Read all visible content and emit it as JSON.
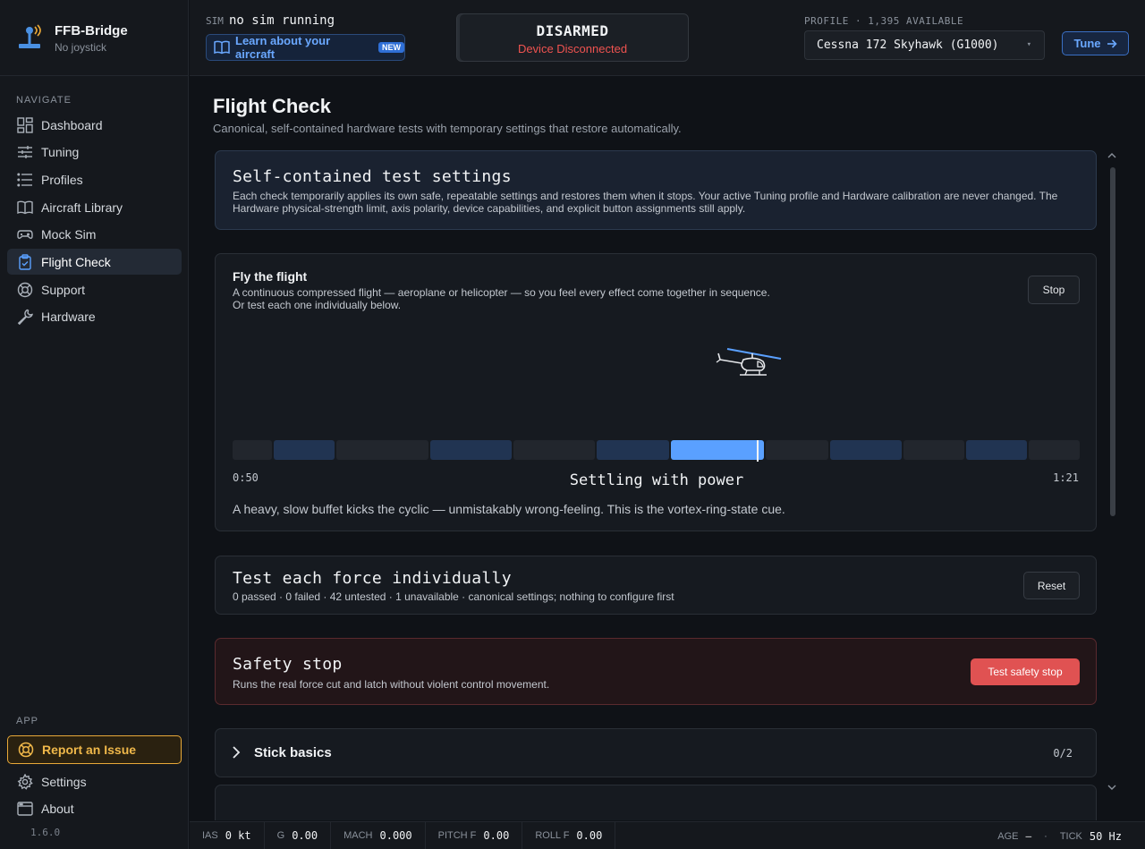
{
  "brand": {
    "name": "FFB-Bridge",
    "subtitle": "No joystick"
  },
  "sidebar": {
    "navigate_label": "NAVIGATE",
    "items": [
      {
        "label": "Dashboard",
        "icon": "dashboard-icon"
      },
      {
        "label": "Tuning",
        "icon": "sliders-icon"
      },
      {
        "label": "Profiles",
        "icon": "list-icon"
      },
      {
        "label": "Aircraft Library",
        "icon": "book-icon"
      },
      {
        "label": "Mock Sim",
        "icon": "gamepad-icon"
      },
      {
        "label": "Flight Check",
        "icon": "clipboard-check-icon",
        "active": true
      },
      {
        "label": "Support",
        "icon": "lifebuoy-icon"
      },
      {
        "label": "Hardware",
        "icon": "wrench-icon"
      }
    ],
    "app_label": "APP",
    "report_label": "Report an Issue",
    "settings_label": "Settings",
    "about_label": "About",
    "version": "1.6.0"
  },
  "topbar": {
    "sim_label": "SIM",
    "sim_value": "no sim running",
    "learn_label": "Learn about your aircraft",
    "learn_badge": "NEW",
    "arm_status": "DISARMED",
    "arm_sub": "Device Disconnected",
    "profile_label": "PROFILE · 1,395 AVAILABLE",
    "profile_value": "Cessna 172 Skyhawk (G1000)",
    "tune_label": "Tune"
  },
  "page": {
    "title": "Flight Check",
    "subtitle": "Canonical, self-contained hardware tests with temporary settings that restore automatically."
  },
  "settings_card": {
    "title": "Self-contained test settings",
    "body_line1": "Each check temporarily applies its own safe, repeatable settings and restores them when it stops. Your active Tuning profile and Hardware calibration are never changed. The",
    "body_line2": "Hardware physical-strength limit, axis polarity, device capabilities, and explicit button assignments still apply."
  },
  "flight_card": {
    "title": "Fly the flight",
    "body_line1": "A continuous compressed flight — aeroplane or helicopter — so you feel every effect come together in sequence.",
    "body_line2": "Or test each one individually below.",
    "stop_label": "Stop",
    "time_start": "0:50",
    "time_end": "1:21",
    "current_phase": "Settling with power",
    "phase_description": "A heavy, slow buffet kicks the cyclic — unmistakably wrong-feeling. This is the vortex-ring-state cue.",
    "progress": 0.62,
    "segments": [
      {
        "w": 44,
        "state": "idle"
      },
      {
        "w": 68,
        "state": "tested"
      },
      {
        "w": 103,
        "state": "idle"
      },
      {
        "w": 91,
        "state": "tested"
      },
      {
        "w": 91,
        "state": "idle"
      },
      {
        "w": 80,
        "state": "tested"
      },
      {
        "w": 104,
        "state": "current"
      },
      {
        "w": 70,
        "state": "idle"
      },
      {
        "w": 80,
        "state": "tested"
      },
      {
        "w": 68,
        "state": "idle"
      },
      {
        "w": 68,
        "state": "tested"
      },
      {
        "w": 57,
        "state": "idle"
      }
    ]
  },
  "individual_card": {
    "title": "Test each force individually",
    "summary": "0 passed · 0 failed · 42 untested · 1 unavailable · canonical settings; nothing to configure first",
    "reset_label": "Reset"
  },
  "safety_card": {
    "title": "Safety stop",
    "body": "Runs the real force cut and latch without violent control movement.",
    "button_label": "Test safety stop"
  },
  "stick_basics": {
    "title": "Stick basics",
    "count": "0/2"
  },
  "statusbar": {
    "ias_label": "IAS",
    "ias_value": "0 kt",
    "g_label": "G",
    "g_value": "0.00",
    "mach_label": "MACH",
    "mach_value": "0.000",
    "pitch_label": "PITCH F",
    "pitch_value": "0.00",
    "roll_label": "ROLL F",
    "roll_value": "0.00",
    "age_label": "AGE",
    "age_value": "—",
    "dot": "·",
    "tick_label": "TICK",
    "tick_value": "50 Hz"
  },
  "colors": {
    "accent": "#5aa0ff",
    "danger": "#e05252",
    "warning": "#f0b84a"
  }
}
